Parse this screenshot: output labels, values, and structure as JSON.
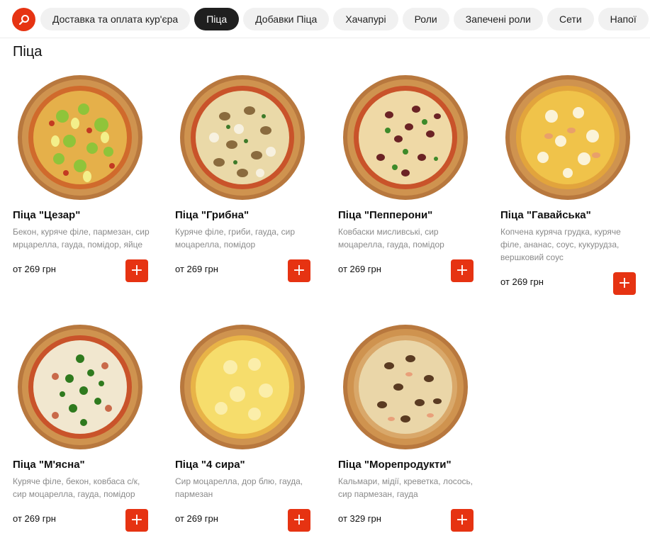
{
  "colors": {
    "accent": "#e63312",
    "active_tab": "#1f1f1f"
  },
  "header": {
    "search_icon": "search-icon",
    "categories": [
      {
        "label": "Доставка та оплата кур'єра",
        "active": false
      },
      {
        "label": "Піца",
        "active": true
      },
      {
        "label": "Добавки Піца",
        "active": false
      },
      {
        "label": "Хачапурі",
        "active": false
      },
      {
        "label": "Роли",
        "active": false
      },
      {
        "label": "Запечені роли",
        "active": false
      },
      {
        "label": "Сети",
        "active": false
      },
      {
        "label": "Напої",
        "active": false
      }
    ]
  },
  "section": {
    "title": "Піца"
  },
  "products": [
    {
      "name": "Піца \"Цезар\"",
      "description": "Бекон, куряче філе, пармезан, сир мрцарелла, гауда, помідор, яйце",
      "price": "от 269 грн",
      "add_icon": "plus-icon"
    },
    {
      "name": "Піца \"Грибна\"",
      "description": "Куряче філе, гриби, гауда, сир моцарелла, помідор",
      "price": "от 269 грн",
      "add_icon": "plus-icon"
    },
    {
      "name": "Піца \"Пепперони\"",
      "description": "Ковбаски мисливські, сир моцарелла, гауда, помідор",
      "price": "от 269 грн",
      "add_icon": "plus-icon"
    },
    {
      "name": "Піца \"Гавайська\"",
      "description": "Копчена куряча грудка, куряче філе, ананас, соус, кукурудза, вершковий соус",
      "price": "от 269 грн",
      "add_icon": "plus-icon"
    },
    {
      "name": "Піца \"М'ясна\"",
      "description": "Куряче філе, бекон, ковбаса с/к, сир моцарелла, гауда, помідор",
      "price": "от 269 грн",
      "add_icon": "plus-icon"
    },
    {
      "name": "Піца \"4 сира\"",
      "description": "Сир моцарелла, дор блю, гауда, пармезан",
      "price": "от 269 грн",
      "add_icon": "plus-icon"
    },
    {
      "name": "Піца \"Морепродукти\"",
      "description": "Кальмари, мідії, креветка, лосось, сир пармезан, гауда",
      "price": "от 329 грн",
      "add_icon": "plus-icon"
    }
  ]
}
